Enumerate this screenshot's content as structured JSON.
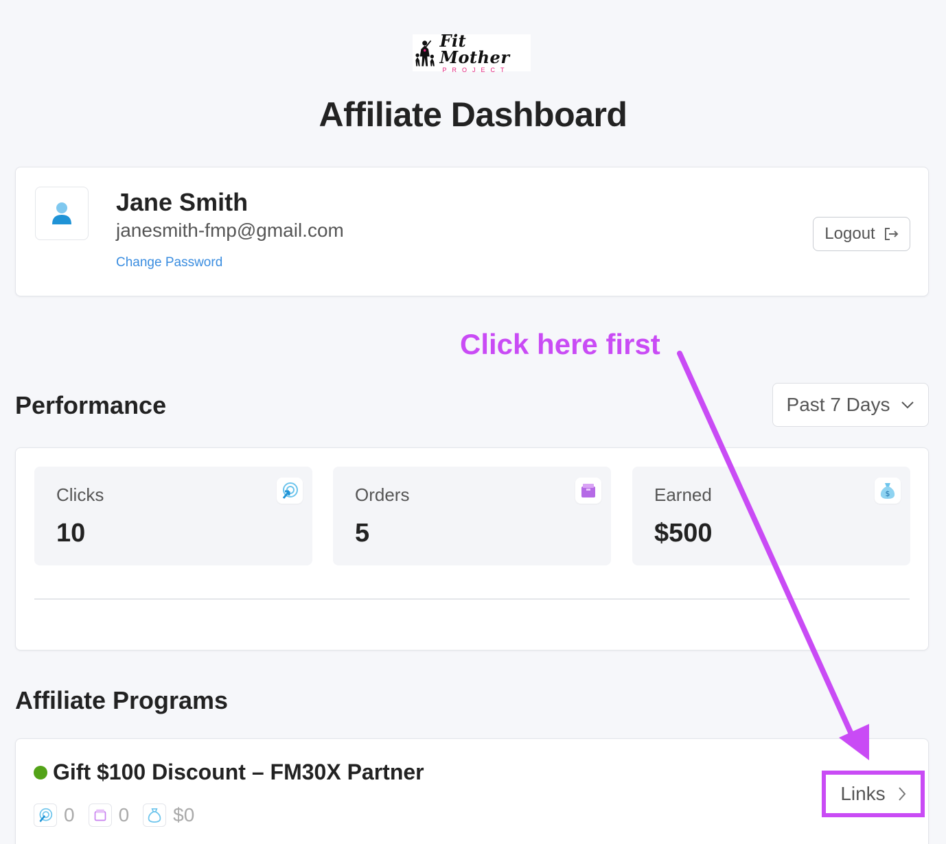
{
  "brand": {
    "logo_script": "Fit Mother",
    "logo_sub": "PROJECT"
  },
  "header": {
    "title": "Affiliate Dashboard"
  },
  "profile": {
    "name": "Jane Smith",
    "email": "janesmith-fmp@gmail.com",
    "change_password_label": "Change Password",
    "logout_label": "Logout"
  },
  "annotation": {
    "text": "Click here first",
    "color": "#c94bf5"
  },
  "performance": {
    "title": "Performance",
    "range_label": "Past 7 Days",
    "stats": [
      {
        "label": "Clicks",
        "value": "10",
        "icon": "cursor-target-icon"
      },
      {
        "label": "Orders",
        "value": "5",
        "icon": "box-icon"
      },
      {
        "label": "Earned",
        "value": "$500",
        "icon": "money-bag-icon"
      }
    ]
  },
  "programs": {
    "title": "Affiliate Programs",
    "items": [
      {
        "name": "Gift $100 Discount – FM30X Partner",
        "status_color": "#53a318",
        "clicks": "0",
        "orders": "0",
        "earned": "$0",
        "links_label": "Links"
      }
    ]
  }
}
